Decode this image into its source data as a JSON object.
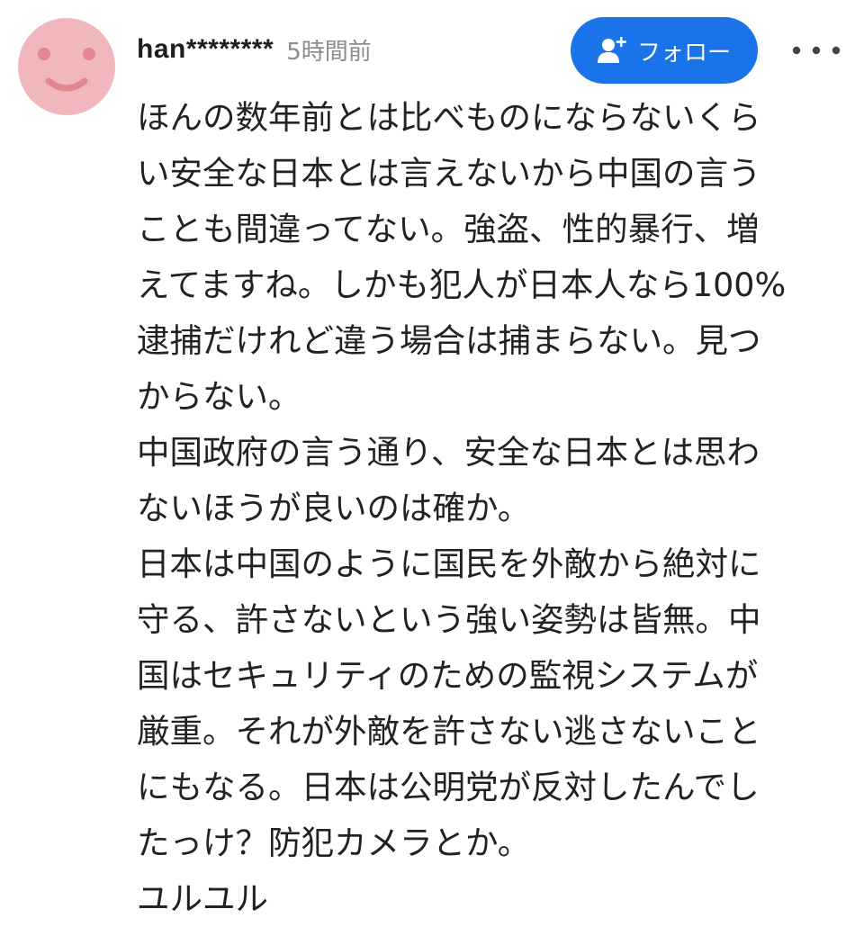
{
  "comment": {
    "username": "han********",
    "timestamp": "5時間前",
    "follow_label": "フォロー",
    "follow_icon": "add-user-icon",
    "more_icon": "more-horizontal-icon",
    "avatar": {
      "style": "smiley-face",
      "face_color": "#f0b8bd",
      "feature_color": "#e2868f"
    },
    "accent_color": "#1a73e8",
    "body_lines": [
      "ほんの数年前とは比べものにならないくら",
      "い安全な日本とは言えないから中国の言う",
      "ことも間違ってない。強盗、性的暴行、増",
      "えてますね。しかも犯人が日本人なら100%",
      "逮捕だけれど違う場合は捕まらない。見つ",
      "からない。",
      "中国政府の言う通り、安全な日本とは思わ",
      "ないほうが良いのは確か。",
      "日本は中国のように国民を外敵から絶対に",
      "守る、許さないという強い姿勢は皆無。中",
      "国はセキュリティのための監視システムが",
      "厳重。それが外敵を許さない逃さないこと",
      "にもなる。日本は公明党が反対したんでし",
      "たっけ？防犯カメラとか。",
      "ユルユル"
    ]
  }
}
